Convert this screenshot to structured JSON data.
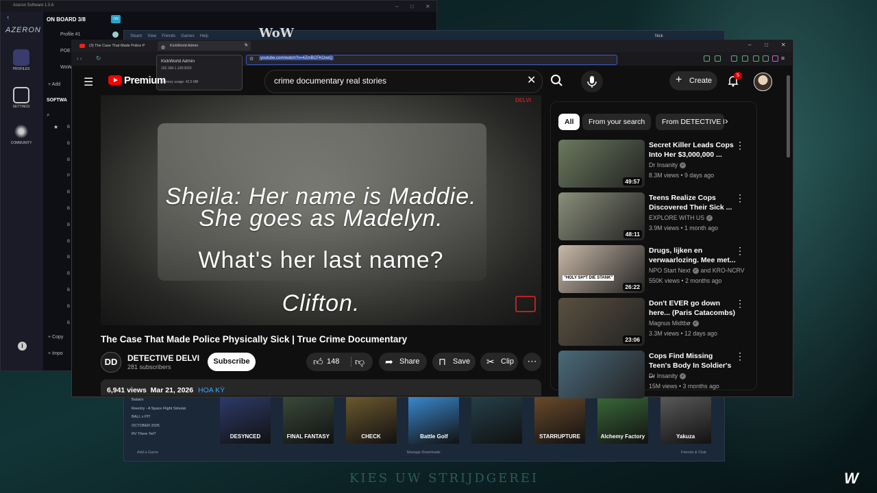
{
  "desktop": {
    "bottom_text": "KIES UW STRIJDGEREI",
    "wow_title": "WoW"
  },
  "azeron": {
    "title": "Azeron Software 1.5.6",
    "logo": "AZERON",
    "nav": [
      {
        "label": "PROFILES",
        "icon": "grid-icon"
      },
      {
        "label": "SETTINGS",
        "icon": "sliders-icon"
      },
      {
        "label": "COMMUNITY",
        "icon": "dragon-icon"
      }
    ],
    "onboard": "ON BOARD 3/8",
    "on_badge": "ON",
    "profiles": [
      "Profile #1",
      "POE",
      "WoW"
    ],
    "add_label": "Add",
    "software_label": "SOFTWA",
    "list_items": [
      "B",
      "B",
      "B",
      "P",
      "B",
      "B",
      "B",
      "B",
      "B",
      "B",
      "B",
      "B",
      "B"
    ],
    "copy_label": "Copy",
    "import_label": "Impo"
  },
  "steam": {
    "menu": [
      "Steam",
      "View",
      "Friends",
      "Games",
      "Help"
    ],
    "user": "Nick",
    "library": [
      "Balatro",
      "Reentry - A Space Flight Simulat",
      "BALL x PIT",
      "OCTOBER 2025",
      "RV There Yet?"
    ],
    "games": [
      {
        "name": "DESYNCED",
        "color": "#2e3b6b"
      },
      {
        "name": "FINAL FANTASY",
        "color": "#3a4a3a"
      },
      {
        "name": "CHECK",
        "color": "#6d5a2e"
      },
      {
        "name": "Battle Golf",
        "color": "#3a8ad0"
      },
      {
        "name": "",
        "color": "#25404a"
      },
      {
        "name": "STARRUPTURE",
        "color": "#6a4a2a"
      },
      {
        "name": "Alchemy Factory",
        "color": "#3a6a3a"
      },
      {
        "name": "Yakuza",
        "color": "#5a5a5a"
      }
    ],
    "add_game": "Add a Game",
    "manage_downloads": "Manage Downloads",
    "friends_chat": "Friends & Chat"
  },
  "browser": {
    "tabs": [
      {
        "label": "(3) The Case That Made Police P",
        "icon": "youtube-icon"
      },
      {
        "label": "KickWorld Admin",
        "icon": "globe-icon"
      }
    ],
    "url": "youtube.com/watch?v=4ZmBCFKOxeQ",
    "tooltip": {
      "title": "KickWorld Admin",
      "address": "192.168.1.128:3020",
      "memory": "Memory usage: 42.5 MB"
    }
  },
  "youtube": {
    "logo_text": "Premium",
    "search_query": "crime documentary real stories",
    "create_label": "Create",
    "notification_count": "5",
    "video": {
      "subtitles": [
        "Sheila: Her name is Maddie.",
        "She goes as Madelyn.",
        "What's her last name?",
        "Clifton."
      ],
      "watermark": "DELVI",
      "title": "The Case That Made Police Physically Sick | True Crime Documentary",
      "channel": "DETECTIVE DELVI",
      "channel_initials": "DD",
      "subscribers": "281 subscribers",
      "subscribe_label": "Subscribe",
      "likes": "148",
      "share_label": "Share",
      "save_label": "Save",
      "clip_label": "Clip",
      "views": "6,941 views",
      "date": "Mar 21, 2026",
      "tag": "HOA KỲ"
    },
    "chips": [
      "All",
      "From your search",
      "From DETECTIVE DELVI"
    ],
    "related": [
      {
        "title": "Secret Killer Leads Cops Into Her $3,000,000 ...",
        "channel": "Dr Insanity",
        "verified": true,
        "meta": "8.3M views • 9 days ago",
        "duration": "49:57",
        "thumb": "#6b7a5e"
      },
      {
        "title": "Teens Realize Cops Discovered Their Sick ...",
        "channel": "EXPLORE WITH US",
        "verified": true,
        "meta": "3.9M views • 1 month ago",
        "duration": "48:11",
        "thumb": "#8a8f7a"
      },
      {
        "title": "Drugs, lijken en verwaarlozing. Mee met...",
        "channel": "NPO Start Next",
        "verified": true,
        "channel_extra": "and KRO-NCRV",
        "meta": "550K views • 2 months ago",
        "duration": "26:22",
        "thumb": "#c9b9a8",
        "thumb_text": "\"HOLY SH*T DIE STANK\""
      },
      {
        "title": "Don't EVER go down here... (Paris Catacombs)",
        "channel": "Magnus Midtbø",
        "verified": true,
        "meta": "3.3M views • 12 days ago",
        "duration": "23:06",
        "thumb": "#5a5040"
      },
      {
        "title": "Cops Find Missing Teen's Body In Soldier's ...",
        "channel": "Dr Insanity",
        "verified": true,
        "meta": "15M views • 3 months ago",
        "duration": "",
        "thumb": "#4a6a7a"
      }
    ]
  }
}
